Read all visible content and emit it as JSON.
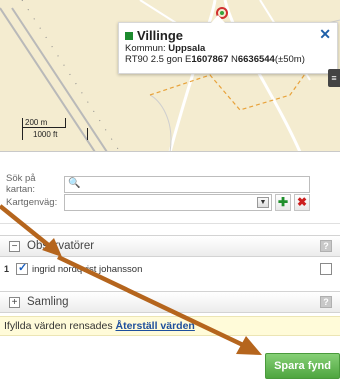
{
  "map": {
    "popup": {
      "title": "Villinge",
      "kommun_label": "Kommun:",
      "kommun_value": "Uppsala",
      "coord_prefix": "RT90 2.5 gon E",
      "coord_e": "1607867",
      "coord_n_prefix": " N",
      "coord_n": "6636544",
      "coord_suffix": "(±50m)",
      "close": "✕"
    },
    "scale": {
      "metric": "200 m",
      "imperial": "1000 ft"
    },
    "layer_button": "≡"
  },
  "search": {
    "sok_label": "Sök på kartan:",
    "sok_icon": "🔍",
    "kartgenvag_label": "Kartgenväg:",
    "dropdown_arrow": "▼",
    "add_icon": "✚",
    "remove_icon": "✖"
  },
  "observers": {
    "title": "Observatörer",
    "toggle": "−",
    "help": "?",
    "rows": [
      {
        "num": "1",
        "name": "ingrid nordqvist johansson"
      }
    ]
  },
  "samling": {
    "title": "Samling",
    "toggle": "+",
    "help": "?"
  },
  "notice": {
    "text": "Ifyllda värden rensades ",
    "link": "Återställ värden"
  },
  "save_button": "Spara fynd",
  "colors": {
    "save_green": "#4ea53f",
    "arrow": "#b5651d",
    "marker_green": "#1c8a2e"
  }
}
